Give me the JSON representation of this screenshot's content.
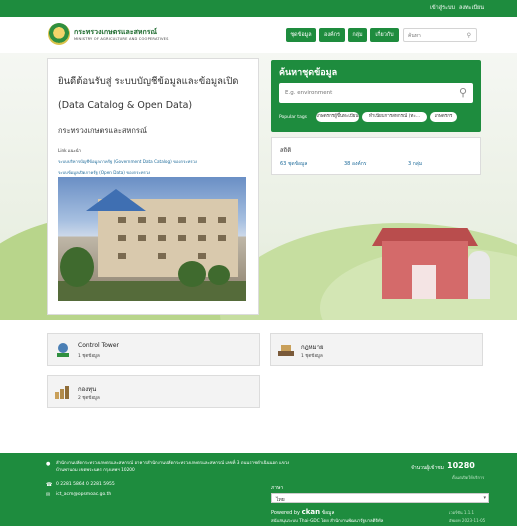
{
  "topbar": {
    "login": "เข้าสู่ระบบ",
    "register": "ลงทะเบียน"
  },
  "header": {
    "logo_title": "กระทรวงเกษตรและสหกรณ์",
    "logo_subtitle": "MINISTRY OF AGRICULTURE AND COOPERATIVES",
    "nav": [
      "ชุดข้อมูล",
      "องค์กร",
      "กลุ่ม",
      "เกี่ยวกับ"
    ],
    "search_placeholder": "ค้นหา"
  },
  "welcome": {
    "title": "ยินดีต้อนรับสู่ ระบบบัญชีข้อมูลและข้อมูลเปิด",
    "subtitle": "(Data Catalog & Open Data)",
    "org": "กระทรวงเกษตรและสหกรณ์",
    "lines": [
      "Link แนะนำ",
      "ระบบบริหารบัญชีข้อมูลภาครัฐ (Government Data Catalog) ของกระทรวง",
      "ระบบข้อมูลเปิดภาครัฐ (Open Data) ของกระทรวง"
    ]
  },
  "search": {
    "title": "ค้นหาชุดข้อมูล",
    "placeholder": "E.g. environment",
    "popular_label": "Popular tags",
    "tags": [
      "เกษตรกรผู้ขึ้นทะเบียน",
      "ทำเนียบการสหกรณ์ (ทะ...",
      "เกษตรกร"
    ]
  },
  "stats": {
    "title": "สถิติ",
    "items": [
      "63 ชุดข้อมูล",
      "38 องค์กร",
      "3 กลุ่ม"
    ]
  },
  "groups": [
    {
      "name": "Control Tower",
      "count": "1 ชุดข้อมูล"
    },
    {
      "name": "กฎหมาย",
      "count": "1 ชุดข้อมูล"
    },
    {
      "name": "กองทุน",
      "count": "2 ชุดข้อมูล"
    }
  ],
  "footer": {
    "address": "สำนักงานปลัดกระทรวงเกษตรและสหกรณ์ อาคารสำนักงานปลัดกระทรวงเกษตรและสหกรณ์ เลขที่ 3 ถนนราชดำเนินนอก แขวงบ้านพานถม เขตพระนคร กรุงเทพฯ 10200",
    "phone": "0 2281 5864 0 2281 5955",
    "email": "ict_acm@opsmoac.go.th",
    "visitor_label": "จำนวนผู้เข้าชม",
    "visitor_count": "10280",
    "visitor_sub": "ตั้งแต่เปิดให้บริการ",
    "language_label": "ภาษา",
    "language_value": "ไทย",
    "powered_prefix": "Powered by",
    "powered_ckan": "ckan",
    "powered_demo": "ข้อมูล",
    "support": "สนับสนุนระบบ Thai-GDC โดย สำนักงานพัฒนารัฐบาลดิจิทัล",
    "version": "เวอร์ชัน 1.1.1",
    "date": "อัพเดท 2023-11-05"
  }
}
